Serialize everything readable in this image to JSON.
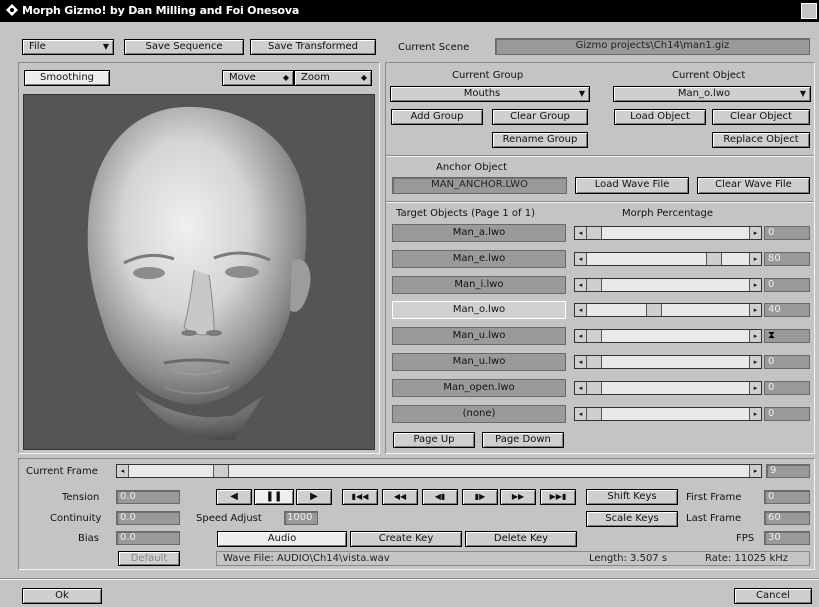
{
  "window": {
    "title": "Morph Gizmo! by Dan Milling and Foi Onesova"
  },
  "toolbar": {
    "file_menu": "File",
    "save_sequence": "Save Sequence",
    "save_transformed": "Save Transformed",
    "current_scene_label": "Current Scene",
    "current_scene_value": "Gizmo projects\\Ch14\\man1.giz"
  },
  "viewport": {
    "smoothing": "Smoothing",
    "move": "Move",
    "zoom": "Zoom"
  },
  "group": {
    "label": "Current Group",
    "value": "Mouths",
    "add": "Add Group",
    "clear": "Clear Group",
    "rename": "Rename Group"
  },
  "object": {
    "label": "Current Object",
    "value": "Man_o.lwo",
    "load": "Load Object",
    "clear": "Clear Object",
    "replace": "Replace Object"
  },
  "anchor": {
    "label": "Anchor Object",
    "value": "MAN_ANCHOR.LWO",
    "load_wave": "Load Wave File",
    "clear_wave": "Clear Wave File"
  },
  "targets": {
    "header_left": "Target Objects  (Page 1 of 1)",
    "header_right": "Morph Percentage",
    "rows": [
      {
        "name": "Man_a.lwo",
        "value": "0",
        "pos": 0
      },
      {
        "name": "Man_e.lwo",
        "value": "80",
        "pos": 0.8
      },
      {
        "name": "Man_i.lwo",
        "value": "0",
        "pos": 0
      },
      {
        "name": "Man_o.lwo",
        "value": "40",
        "pos": 0.4
      },
      {
        "name": "Man_u.lwo",
        "value": "",
        "pos": 0
      },
      {
        "name": "Man_u.lwo",
        "value": "0",
        "pos": 0
      },
      {
        "name": "Man_open.lwo",
        "value": "0",
        "pos": 0
      },
      {
        "name": "(none)",
        "value": "0",
        "pos": 0
      }
    ],
    "page_up": "Page Up",
    "page_down": "Page Down"
  },
  "timeline": {
    "current_frame_label": "Current Frame",
    "current_frame_value": "9",
    "position": 0.14
  },
  "params": {
    "tension_label": "Tension",
    "tension_value": "0.0",
    "continuity_label": "Continuity",
    "continuity_value": "0.0",
    "bias_label": "Bias",
    "bias_value": "0.0",
    "default_button": "Default"
  },
  "transport": {
    "speed_label": "Speed Adjust",
    "speed_value": "1000",
    "audio": "Audio",
    "create_key": "Create Key",
    "delete_key": "Delete Key",
    "wave_file": "Wave File: AUDIO\\Ch14\\vista.wav",
    "length": "Length: 3.507 s",
    "rate": "Rate: 11025 kHz"
  },
  "keys": {
    "shift": "Shift Keys",
    "scale": "Scale Keys",
    "first_frame_label": "First Frame",
    "first_frame_value": "0",
    "last_frame_label": "Last Frame",
    "last_frame_value": "60",
    "fps_label": "FPS",
    "fps_value": "30"
  },
  "footer": {
    "ok": "Ok",
    "cancel": "Cancel"
  }
}
